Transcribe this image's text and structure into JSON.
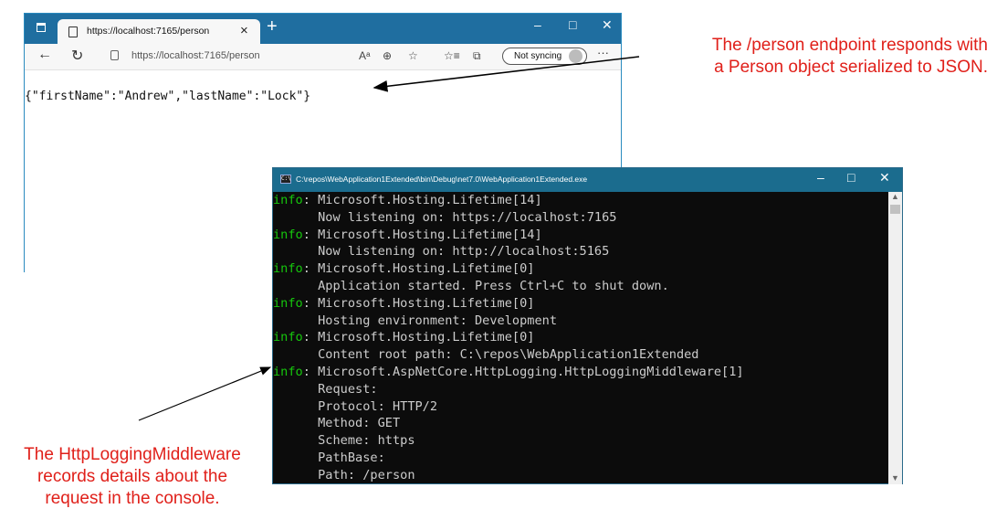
{
  "browser": {
    "tab_title": "https://localhost:7165/person",
    "tab_close": "×",
    "new_tab": "+",
    "window_controls": [
      "–",
      "□",
      "✕"
    ],
    "address_url": "https://localhost:7165/person",
    "sync_label": "Not syncing",
    "more": "···",
    "toolbar_icons": [
      "Aᵃ",
      "⊕",
      "☆",
      "☆≡",
      "⧉"
    ],
    "content_text": "{\"firstName\":\"Andrew\",\"lastName\":\"Lock\"}"
  },
  "console": {
    "title": "C:\\repos\\WebApplication1Extended\\bin\\Debug\\net7.0\\WebApplication1Extended.exe",
    "window_controls": [
      "–",
      "□",
      "✕"
    ],
    "icon_text": "C:\\",
    "lines": [
      {
        "prefix": "info",
        "text": ": Microsoft.Hosting.Lifetime[14]"
      },
      {
        "prefix": "",
        "text": "      Now listening on: https://localhost:7165"
      },
      {
        "prefix": "info",
        "text": ": Microsoft.Hosting.Lifetime[14]"
      },
      {
        "prefix": "",
        "text": "      Now listening on: http://localhost:5165"
      },
      {
        "prefix": "info",
        "text": ": Microsoft.Hosting.Lifetime[0]"
      },
      {
        "prefix": "",
        "text": "      Application started. Press Ctrl+C to shut down."
      },
      {
        "prefix": "info",
        "text": ": Microsoft.Hosting.Lifetime[0]"
      },
      {
        "prefix": "",
        "text": "      Hosting environment: Development"
      },
      {
        "prefix": "info",
        "text": ": Microsoft.Hosting.Lifetime[0]"
      },
      {
        "prefix": "",
        "text": "      Content root path: C:\\repos\\WebApplication1Extended"
      },
      {
        "prefix": "info",
        "text": ": Microsoft.AspNetCore.HttpLogging.HttpLoggingMiddleware[1]"
      },
      {
        "prefix": "",
        "text": "      Request:"
      },
      {
        "prefix": "",
        "text": "      Protocol: HTTP/2"
      },
      {
        "prefix": "",
        "text": "      Method: GET"
      },
      {
        "prefix": "",
        "text": "      Scheme: https"
      },
      {
        "prefix": "",
        "text": "      PathBase:"
      },
      {
        "prefix": "",
        "text": "      Path: /person"
      }
    ]
  },
  "annotations": {
    "top_line1": "The /person endpoint responds with",
    "top_line2": "a Person object serialized to JSON.",
    "bottom_line1": "The HttpLoggingMiddleware",
    "bottom_line2": "records details about the",
    "bottom_line3": "request in the console."
  },
  "colors": {
    "annotation": "#e0201a",
    "info_green": "#16c60c",
    "console_bg": "#0c0c0c",
    "titlebar_blue": "#1f6ea0"
  }
}
